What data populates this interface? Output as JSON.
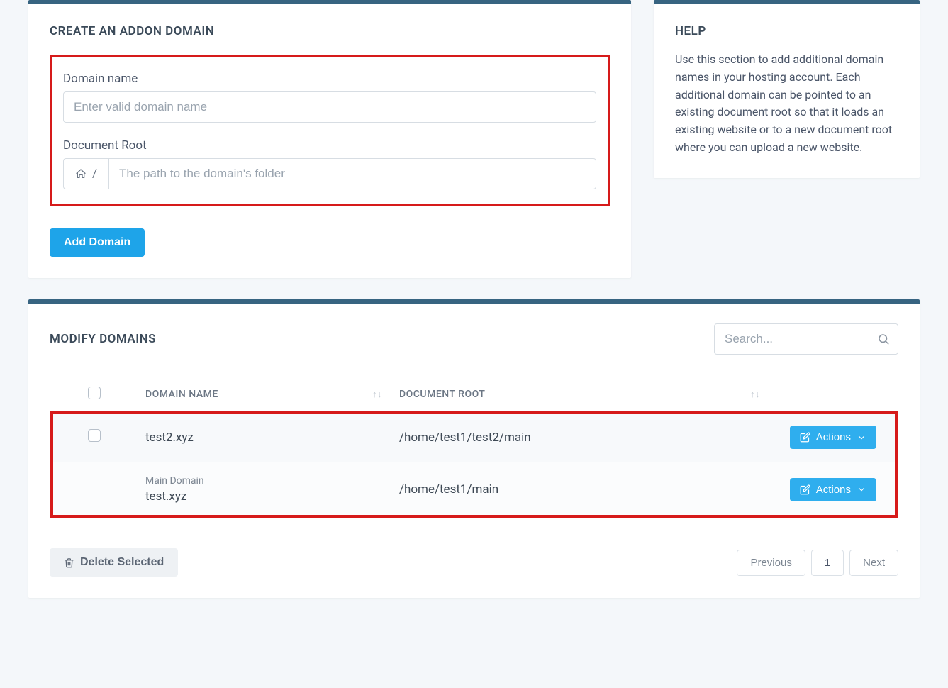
{
  "create_panel": {
    "title": "CREATE AN ADDON DOMAIN",
    "domain_label": "Domain name",
    "domain_placeholder": "Enter valid domain name",
    "docroot_label": "Document Root",
    "docroot_prefix": "/",
    "docroot_placeholder": "The path to the domain's folder",
    "submit_label": "Add Domain"
  },
  "help_panel": {
    "title": "HELP",
    "body": "Use this section to add additional domain names in your hosting account. Each additional domain can be pointed to an existing document root so that it loads an existing website or to a new document root where you can upload a new website."
  },
  "modify_panel": {
    "title": "MODIFY DOMAINS",
    "search_placeholder": "Search...",
    "columns": {
      "domain": "DOMAIN NAME",
      "docroot": "DOCUMENT ROOT"
    },
    "rows": [
      {
        "selectable": true,
        "sub": "",
        "domain": "test2.xyz",
        "docroot": "/home/test1/test2/main",
        "actions_label": "Actions"
      },
      {
        "selectable": false,
        "sub": "Main Domain",
        "domain": "test.xyz",
        "docroot": "/home/test1/main",
        "actions_label": "Actions"
      }
    ],
    "delete_label": "Delete Selected",
    "pager": {
      "prev": "Previous",
      "page": "1",
      "next": "Next"
    }
  }
}
